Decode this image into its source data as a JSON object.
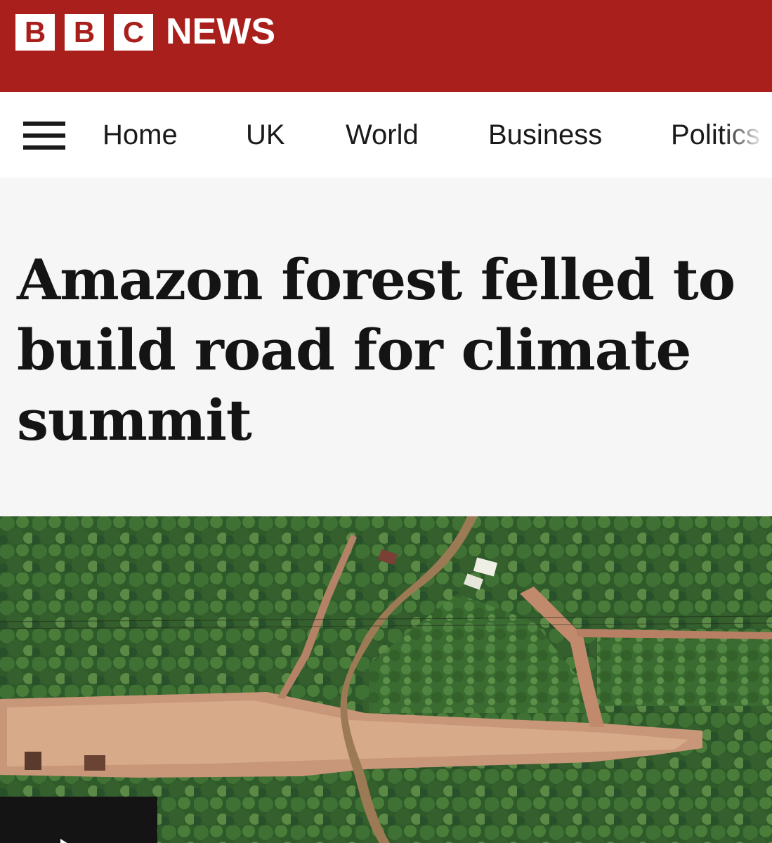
{
  "brand": {
    "letters": [
      "B",
      "B",
      "C"
    ],
    "name": "NEWS",
    "color": "#a91f1c"
  },
  "nav": {
    "menu_icon": "hamburger-menu-icon",
    "items": [
      "Home",
      "UK",
      "World",
      "Business",
      "Politics"
    ]
  },
  "article": {
    "headline": "Amazon forest felled to build road for climate summit"
  },
  "media": {
    "image_icon": "aerial-forest-road-photo",
    "play_icon": "play-icon"
  }
}
